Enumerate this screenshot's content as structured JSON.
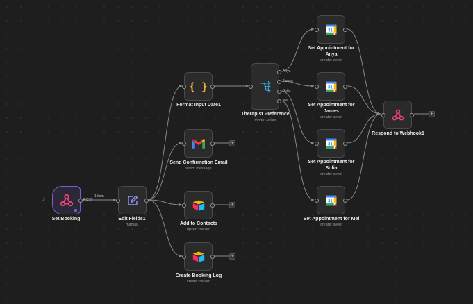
{
  "colors": {
    "canvas": "#1e1e1e",
    "node": "#2b2b2b",
    "trigger_border": "#7d5bd6",
    "wire": "#8a8a8a",
    "webhook_icon": "#e8447a",
    "edit_icon": "#8f8ff5",
    "code_icon": "#f5b13a",
    "switch_icon": "#3aa9e6"
  },
  "nodes": {
    "set_booking": {
      "name": "Set Booking",
      "icon": "webhook-icon",
      "method": "POST",
      "edge_label": "1 item"
    },
    "edit_fields": {
      "name": "Edit Fields1",
      "sub": "manual",
      "icon": "pencil-icon"
    },
    "format_date": {
      "name": "Format Input Date1",
      "icon": "code-braces-icon"
    },
    "send_email": {
      "name": "Send Confirmation Email",
      "sub": "send: message",
      "icon": "gmail-icon"
    },
    "add_contacts": {
      "name": "Add to Contacts",
      "sub": "upsert: record",
      "icon": "airtable-icon"
    },
    "booking_log": {
      "name": "Create Booking Log",
      "sub": "create: record",
      "icon": "airtable-icon"
    },
    "therapist": {
      "name": "Therapist Preference",
      "sub": "mode: Rules",
      "icon": "switch-icon",
      "outputs": [
        "Anya",
        "James",
        "Sofia",
        "Mei"
      ]
    },
    "appt_anya": {
      "name1": "Set Appointment for",
      "name2": "Anya",
      "sub": "create: event",
      "icon": "calendar-icon"
    },
    "appt_james": {
      "name1": "Set Appointment for",
      "name2": "James",
      "sub": "create: event",
      "icon": "calendar-icon"
    },
    "appt_sofia": {
      "name1": "Set Appointment for",
      "name2": "Sofia",
      "sub": "create: event",
      "icon": "calendar-icon"
    },
    "appt_mei": {
      "name": "Set Appointment for Mei",
      "sub": "create: event",
      "icon": "calendar-icon"
    },
    "respond": {
      "name": "Respond to Webhook1",
      "icon": "webhook-icon"
    }
  },
  "calendar_day": "31",
  "plus_symbol": "+"
}
